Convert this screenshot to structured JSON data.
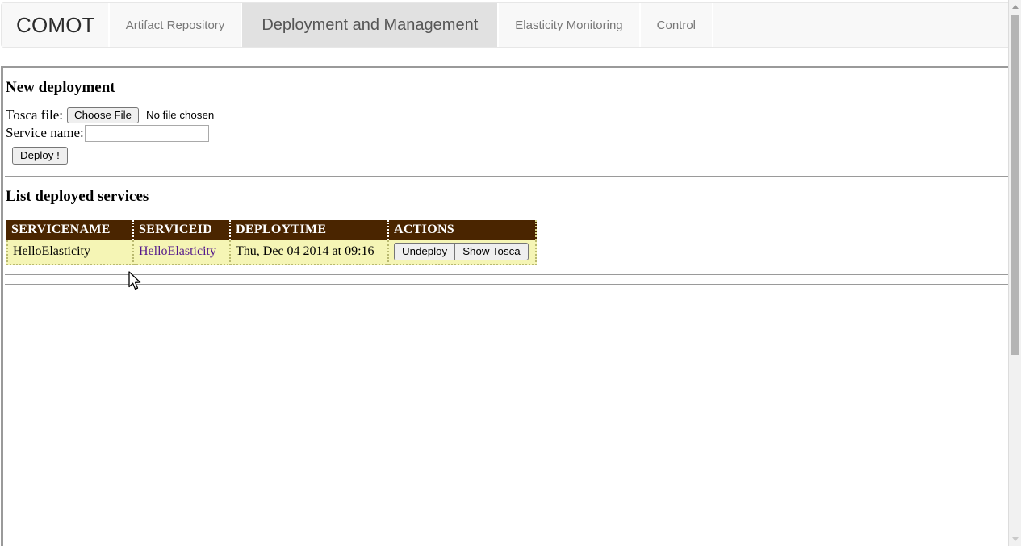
{
  "app": {
    "brand": "COMOT"
  },
  "navbar": {
    "tabs": [
      {
        "label": "Artifact Repository",
        "active": false
      },
      {
        "label": "Deployment and Management",
        "active": true
      },
      {
        "label": "Elasticity Monitoring",
        "active": false
      },
      {
        "label": "Control",
        "active": false
      }
    ]
  },
  "new_deployment": {
    "heading": "New deployment",
    "tosca_label": "Tosca file:",
    "choose_file_label": "Choose File",
    "file_status": "No file chosen",
    "service_name_label": "Service name:",
    "service_name_value": "",
    "service_name_placeholder": "",
    "deploy_label": "Deploy !"
  },
  "deployed_services": {
    "heading": "List deployed services",
    "columns": [
      "SERVICENAME",
      "SERVICEID",
      "DEPLOYTIME",
      "ACTIONS"
    ],
    "rows": [
      {
        "servicename": "HelloElasticity",
        "serviceid": "HelloElasticity",
        "deploytime": "Thu, Dec 04 2014 at 09:16",
        "actions": [
          "Undeploy",
          "Show Tosca"
        ]
      }
    ]
  },
  "colors": {
    "table_header_bg": "#4a2500",
    "table_row_bg": "#f5f5b5",
    "active_tab_bg": "#e1e1e1",
    "navbar_bg": "#f8f8f8",
    "link": "#551a8b",
    "divider": "#9a9a9a"
  },
  "scrollbar": {
    "up_arrow": "triangle-up-icon",
    "down_arrow": "triangle-down-icon"
  }
}
